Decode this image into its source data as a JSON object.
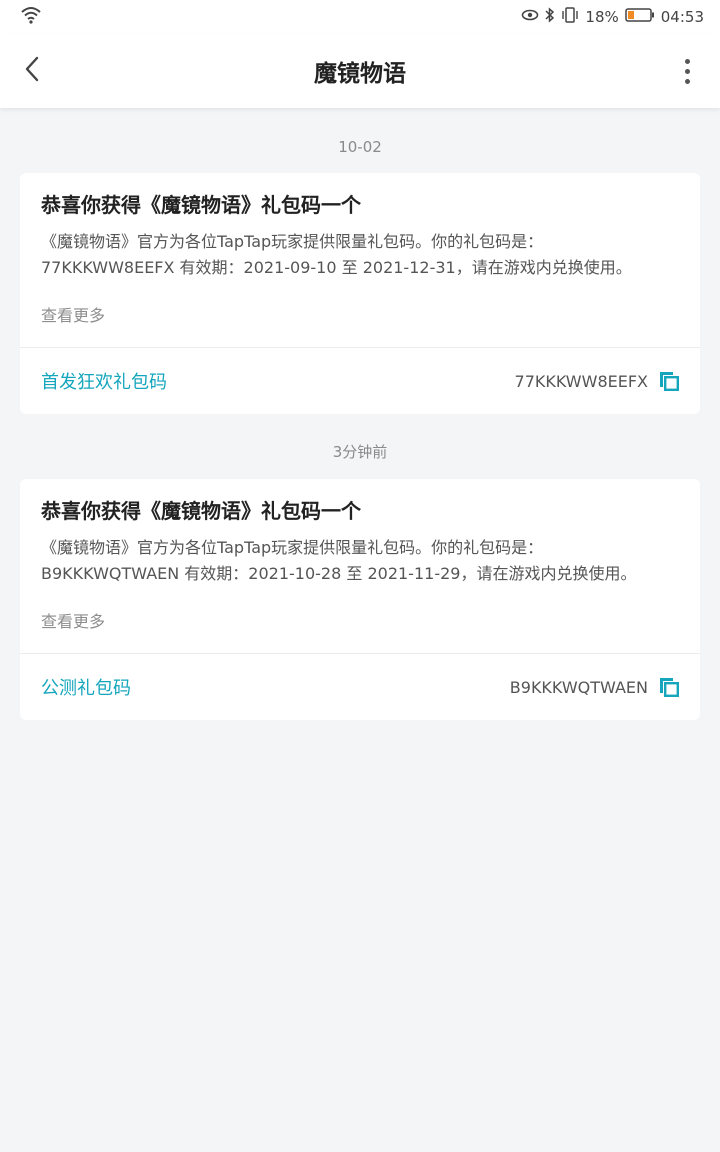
{
  "status_bar": {
    "battery_percent": "18%",
    "time": "04:53"
  },
  "header": {
    "title": "魔镜物语"
  },
  "messages": [
    {
      "date": "10-02",
      "title": "恭喜你获得《魔镜物语》礼包码一个",
      "desc_line1": "《魔镜物语》官方为各位TapTap玩家提供限量礼包码。你的礼包码是：",
      "desc_line2": "77KKKWW8EEFX 有效期：2021-09-10 至 2021-12-31，请在游戏内兑换使用。",
      "view_more": "查看更多",
      "gift_name": "首发狂欢礼包码",
      "gift_code": "77KKKWW8EEFX"
    },
    {
      "date": "3分钟前",
      "title": "恭喜你获得《魔镜物语》礼包码一个",
      "desc_line1": "《魔镜物语》官方为各位TapTap玩家提供限量礼包码。你的礼包码是：",
      "desc_line2": "B9KKKWQTWAEN 有效期：2021-10-28 至 2021-11-29，请在游戏内兑换使用。",
      "view_more": "查看更多",
      "gift_name": "公测礼包码",
      "gift_code": "B9KKKWQTWAEN"
    }
  ],
  "colors": {
    "accent": "#15a6bd",
    "background": "#f4f5f7"
  }
}
